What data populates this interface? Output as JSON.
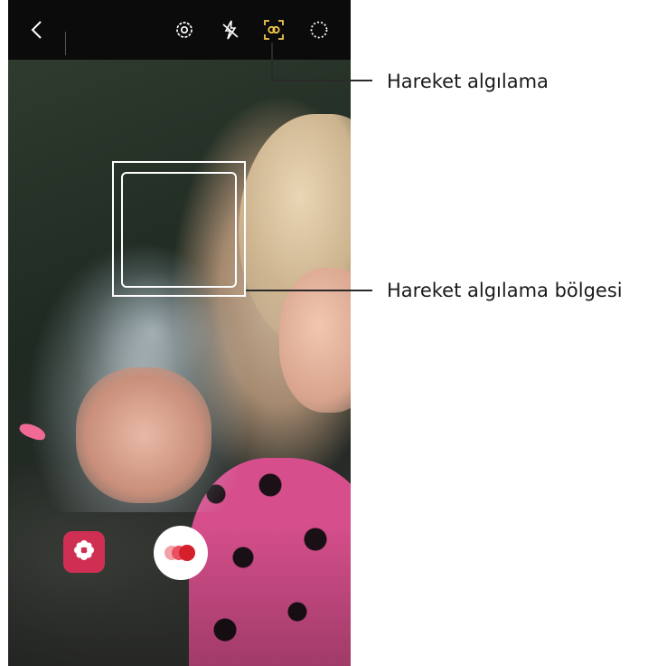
{
  "top_bar": {
    "icons": [
      "back-icon",
      "settings-icon",
      "flash-off-icon",
      "motion-detection-icon",
      "timer-icon"
    ]
  },
  "bottom_controls": {
    "icons": [
      "filter-icon",
      "record-icon"
    ]
  },
  "callouts": {
    "motion_detection": "Hareket algılama",
    "motion_detection_area": "Hareket algılama bölgesi"
  },
  "colors": {
    "highlight": "#f2c94c",
    "filter_button": "#cf2f52",
    "record_dots": [
      "#f3a0a8",
      "#e8505f",
      "#d5202c"
    ]
  }
}
